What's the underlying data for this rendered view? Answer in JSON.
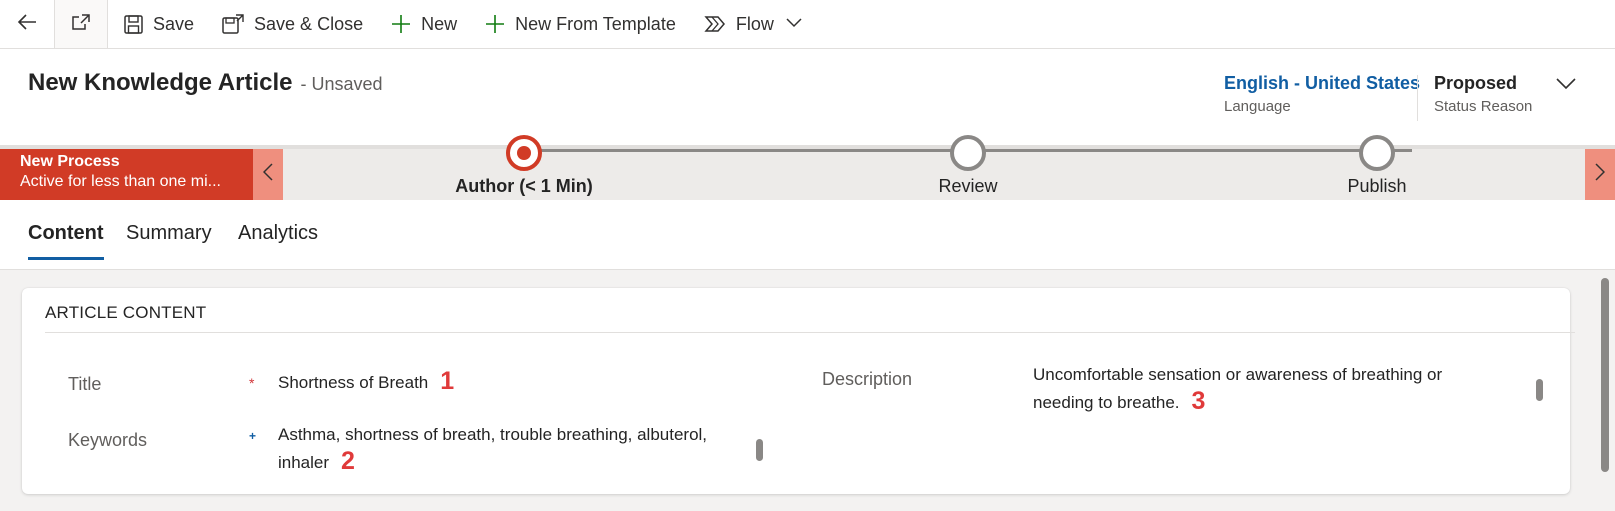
{
  "commandbar": {
    "save": "Save",
    "save_close": "Save & Close",
    "new": "New",
    "new_from_template": "New From Template",
    "flow": "Flow"
  },
  "header": {
    "title": "New Knowledge Article",
    "unsaved": "- Unsaved",
    "language": {
      "value": "English - United States",
      "label": "Language"
    },
    "status": {
      "value": "Proposed",
      "label": "Status Reason"
    }
  },
  "process": {
    "name": "New Process",
    "active_text": "Active for less than one mi...",
    "stages": [
      {
        "label": "Author  (< 1 Min)",
        "active": true
      },
      {
        "label": "Review",
        "active": false
      },
      {
        "label": "Publish",
        "active": false
      }
    ]
  },
  "tabs": [
    "Content",
    "Summary",
    "Analytics"
  ],
  "section": {
    "title": "ARTICLE CONTENT",
    "title_label": "Title",
    "title_required": "*",
    "title_value": "Shortness of Breath",
    "title_marker": "1",
    "keywords_label": "Keywords",
    "keywords_recommended": "+",
    "keywords_value_line1": "Asthma, shortness of breath, trouble breathing, albuterol,",
    "keywords_value_line2": "inhaler",
    "keywords_marker": "2",
    "description_label": "Description",
    "description_line1": "Uncomfortable sensation or awareness of breathing or",
    "description_line2": "needing to breathe.",
    "description_marker": "3"
  },
  "colors": {
    "accent": "#115ea3",
    "process_active": "#d13b26",
    "marker": "#e03a3a"
  }
}
